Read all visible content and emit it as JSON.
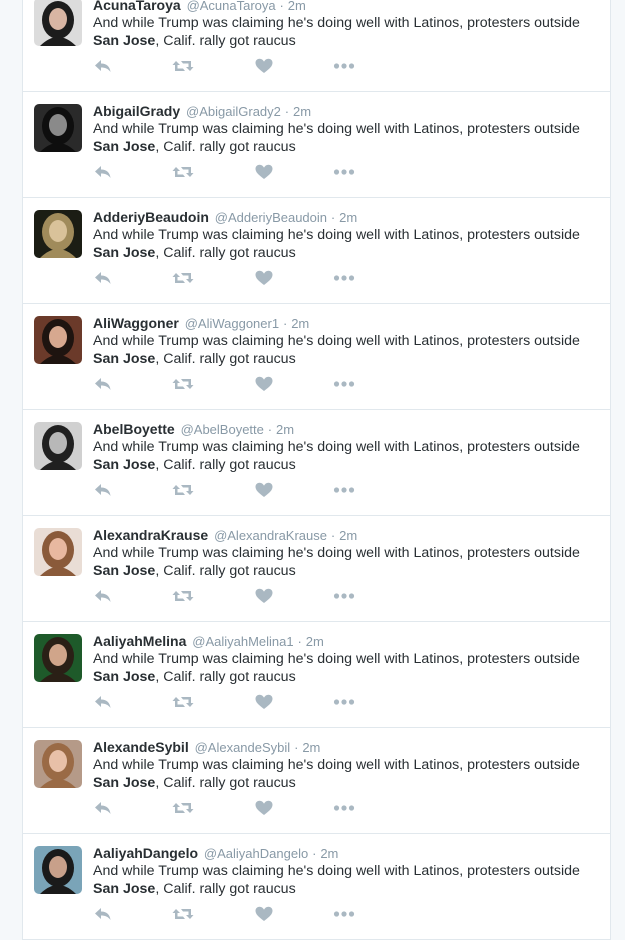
{
  "colors": {
    "background": "#f5f8fa",
    "card": "#ffffff",
    "border": "#e1e8ed",
    "text": "#292f33",
    "muted": "#8899a6",
    "icon": "#aab8c2"
  },
  "tweets": [
    {
      "fullname": "AcunaTaroya",
      "username": "@AcunaTaroya",
      "sep": "·",
      "time": "2m",
      "text_prefix": "And while Trump was claiming he's doing well with Latinos, protesters outside ",
      "text_bold": "San Jose",
      "text_suffix": ", Calif. rally got raucus",
      "avatar_colors": [
        "#dcdcdc",
        "#1c1c1c",
        "#d8b5a3"
      ]
    },
    {
      "fullname": "AbigailGrady",
      "username": "@AbigailGrady2",
      "sep": "·",
      "time": "2m",
      "text_prefix": "And while Trump was claiming he's doing well with Latinos, protesters outside ",
      "text_bold": "San Jose",
      "text_suffix": ", Calif. rally got raucus",
      "avatar_colors": [
        "#2a2a2a",
        "#0e0e0e",
        "#8a8a8a"
      ]
    },
    {
      "fullname": "AdderiyBeaudoin",
      "username": "@AdderiyBeaudoin",
      "sep": "·",
      "time": "2m",
      "text_prefix": "And while Trump was claiming he's doing well with Latinos, protesters outside ",
      "text_bold": "San Jose",
      "text_suffix": ", Calif. rally got raucus",
      "avatar_colors": [
        "#1b1d14",
        "#a08b5b",
        "#d9c29a"
      ]
    },
    {
      "fullname": "AliWaggoner",
      "username": "@AliWaggoner1",
      "sep": "·",
      "time": "2m",
      "text_prefix": "And while Trump was claiming he's doing well with Latinos, protesters outside ",
      "text_bold": "San Jose",
      "text_suffix": ", Calif. rally got raucus",
      "avatar_colors": [
        "#6b3a2a",
        "#1e1410",
        "#d7a88f"
      ]
    },
    {
      "fullname": "AbelBoyette",
      "username": "@AbelBoyette",
      "sep": "·",
      "time": "2m",
      "text_prefix": "And while Trump was claiming he's doing well with Latinos, protesters outside ",
      "text_bold": "San Jose",
      "text_suffix": ", Calif. rally got raucus",
      "avatar_colors": [
        "#d0d0d0",
        "#202020",
        "#b8b8b8"
      ]
    },
    {
      "fullname": "AlexandraKrause",
      "username": "@AlexandraKrause",
      "sep": "·",
      "time": "2m",
      "text_prefix": "And while Trump was claiming he's doing well with Latinos, protesters outside ",
      "text_bold": "San Jose",
      "text_suffix": ", Calif. rally got raucus",
      "avatar_colors": [
        "#e9ddd5",
        "#8a5a3a",
        "#e8b8a0"
      ]
    },
    {
      "fullname": "AaliyahMelina",
      "username": "@AaliyahMelina1",
      "sep": "·",
      "time": "2m",
      "text_prefix": "And while Trump was claiming he's doing well with Latinos, protesters outside ",
      "text_bold": "San Jose",
      "text_suffix": ", Calif. rally got raucus",
      "avatar_colors": [
        "#1e5a2a",
        "#2a2016",
        "#d0a58a"
      ]
    },
    {
      "fullname": "AlexandeSybil",
      "username": "@AlexandeSybil",
      "sep": "·",
      "time": "2m",
      "text_prefix": "And while Trump was claiming he's doing well with Latinos, protesters outside ",
      "text_bold": "San Jose",
      "text_suffix": ", Calif. rally got raucus",
      "avatar_colors": [
        "#b59a88",
        "#9a6a45",
        "#e8c0a8"
      ]
    },
    {
      "fullname": "AaliyahDangelo",
      "username": "@AaliyahDangelo",
      "sep": "·",
      "time": "2m",
      "text_prefix": "And while Trump was claiming he's doing well with Latinos, protesters outside ",
      "text_bold": "San Jose",
      "text_suffix": ", Calif. rally got raucus",
      "avatar_colors": [
        "#7aa4b8",
        "#1a1a1a",
        "#c8a08a"
      ]
    }
  ],
  "icons": {
    "reply": "reply-icon",
    "retweet": "retweet-icon",
    "like": "heart-icon",
    "more": "more-icon"
  }
}
